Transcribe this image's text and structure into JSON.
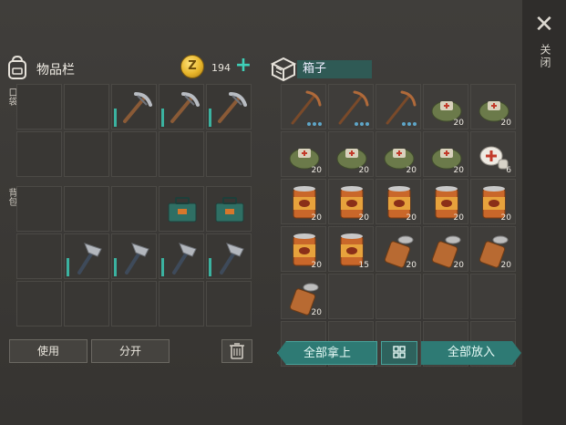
{
  "close": {
    "label": "关闭"
  },
  "inventory": {
    "title": "物品栏",
    "coins": "194",
    "pocket_label": "口袋",
    "backpack_label": "背包"
  },
  "box": {
    "title": "箱子"
  },
  "buttons": {
    "use": "使用",
    "split": "分开",
    "take_all": "全部拿上",
    "put_all": "全部放入"
  },
  "pocket_slots": [
    "",
    "",
    "pickaxe",
    "pickaxe",
    "pickaxe",
    "",
    "",
    "",
    "",
    ""
  ],
  "backpack_slots": [
    "",
    "",
    "",
    "toolbox",
    "toolbox",
    "",
    "hammer",
    "hammer",
    "hammer",
    "hammer",
    "",
    "",
    "",
    "",
    ""
  ],
  "box_slots": [
    {
      "item": "crossbow-pickaxe",
      "count": ""
    },
    {
      "item": "crossbow-pickaxe",
      "count": ""
    },
    {
      "item": "crossbow-pickaxe",
      "count": ""
    },
    {
      "item": "medkit",
      "count": "20"
    },
    {
      "item": "medkit",
      "count": "20"
    },
    {
      "item": "medkit",
      "count": "20"
    },
    {
      "item": "medkit",
      "count": "20"
    },
    {
      "item": "medkit",
      "count": "20"
    },
    {
      "item": "medkit",
      "count": "20"
    },
    {
      "item": "bandage",
      "count": "6"
    },
    {
      "item": "can",
      "count": "20"
    },
    {
      "item": "can",
      "count": "20"
    },
    {
      "item": "can",
      "count": "20"
    },
    {
      "item": "can",
      "count": "20"
    },
    {
      "item": "can",
      "count": "20"
    },
    {
      "item": "can",
      "count": "20"
    },
    {
      "item": "can",
      "count": "15"
    },
    {
      "item": "open-can",
      "count": "20"
    },
    {
      "item": "open-can",
      "count": "20"
    },
    {
      "item": "open-can",
      "count": "20"
    },
    {
      "item": "open-can",
      "count": "20"
    },
    {
      "item": "",
      "count": ""
    },
    {
      "item": "",
      "count": ""
    },
    {
      "item": "",
      "count": ""
    },
    {
      "item": "",
      "count": ""
    },
    {
      "item": "",
      "count": ""
    },
    {
      "item": "",
      "count": ""
    },
    {
      "item": "",
      "count": ""
    },
    {
      "item": "",
      "count": ""
    },
    {
      "item": "",
      "count": ""
    }
  ],
  "icons": {
    "close": "close-icon",
    "backpack": "backpack-icon",
    "coin": "coin-icon",
    "box": "box-icon",
    "trash": "trash-icon",
    "sort": "sort-icon"
  },
  "colors": {
    "accent": "#2e7a74",
    "plus": "#3fd0b8",
    "durability": "#3bb2a0"
  }
}
